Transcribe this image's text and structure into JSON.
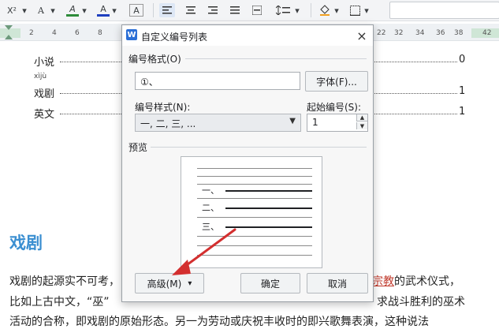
{
  "toolbar": {
    "superscript": "X²",
    "font_effects": "A",
    "highlight": "A",
    "font_color": "A",
    "char_shading": "A",
    "dropdown": "▾"
  },
  "ruler": {
    "ticks": [
      "2",
      "4",
      "6",
      "8",
      "22",
      "24",
      "26",
      "28",
      "30",
      "32",
      "34",
      "36",
      "38",
      "42"
    ]
  },
  "document": {
    "toc": [
      {
        "title": "小说",
        "page": "0"
      },
      {
        "title": "戏剧",
        "ruby": "xìjù",
        "page": "1"
      },
      {
        "title": "英文",
        "page": "1"
      }
    ],
    "heading": "戏剧",
    "para1_left": "戏剧的起源实不可考，",
    "para1_red": "宗教",
    "para1_right": "的武术仪式，",
    "para2_left": "比如上古中文，“巫”",
    "para2_right": "求战斗胜利的巫术",
    "para3": "活动的合称，即戏剧的原始形态。另一为劳动或庆祝丰收时的即兴歌舞表演，这种说法"
  },
  "dialog": {
    "logo": "W",
    "title": "自定义编号列表",
    "close": "×",
    "format_label": "编号格式(O)",
    "format_value": "①、",
    "font_button": "字体(F)...",
    "style_label": "编号样式(N):",
    "style_value": "一, 二, 三, ...",
    "start_label": "起始编号(S):",
    "start_value": "1",
    "preview_label": "预览",
    "preview_items": [
      "一、",
      "二、",
      "三、"
    ],
    "advanced_button": "高级(M)",
    "advanced_arrow": "▾",
    "ok_button": "确定",
    "cancel_button": "取消"
  },
  "colors": {
    "heading": "#3b8fd1",
    "arrow": "#d32f2f",
    "logo": "#2b6fd6"
  }
}
